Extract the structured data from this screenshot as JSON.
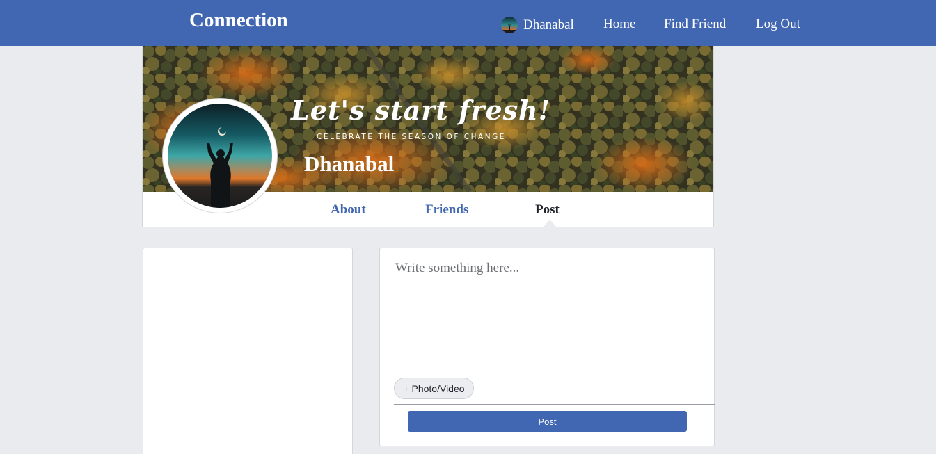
{
  "header": {
    "brand": "Connection",
    "user_name": "Dhanabal",
    "nav": {
      "home": "Home",
      "find_friend": "Find Friend",
      "logout": "Log Out"
    }
  },
  "profile": {
    "cover_title": "Let's start fresh!",
    "cover_subtitle": "CELEBRATE THE SEASON OF CHANGE.",
    "name": "Dhanabal",
    "tabs": {
      "about": "About",
      "friends": "Friends",
      "post": "Post"
    },
    "active_tab": "Post"
  },
  "composer": {
    "placeholder": "Write something here...",
    "photo_button": "+ Photo/Video",
    "post_button": "Post"
  },
  "colors": {
    "brand_blue": "#4267b2",
    "page_bg": "#e9ebee"
  }
}
